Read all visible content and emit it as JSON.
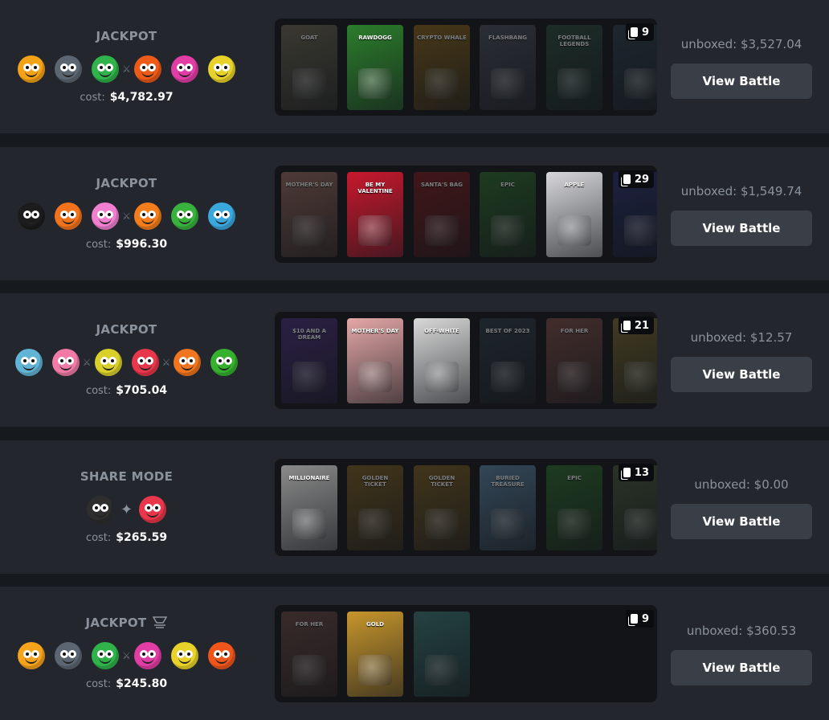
{
  "battles": [
    {
      "mode": "JACKPOT",
      "cost_label": "cost:",
      "cost": "$4,782.97",
      "unboxed": "unboxed: $3,527.04",
      "case_count": "9",
      "button": "View Battle",
      "players": [
        {
          "icon": "orange-smiley-avatar",
          "color": "#f5a316"
        },
        {
          "icon": "gray-creature-avatar",
          "color": "#5c6672"
        },
        {
          "icon": "green-grin-avatar",
          "color": "#2fb34a"
        },
        {
          "sep": "vs"
        },
        {
          "icon": "orange-blob-avatar",
          "color": "#ee5a17"
        },
        {
          "icon": "pink-eyeball-avatar",
          "color": "#e13da5"
        },
        {
          "icon": "yellow-face-avatar",
          "color": "#e8d22a"
        }
      ],
      "cases": [
        {
          "title": "GOAT",
          "color": "#6d6650",
          "dim": true
        },
        {
          "title": "RAWDOGG",
          "color": "#2b7d2c",
          "dim": false
        },
        {
          "title": "CRYPTO WHALE",
          "color": "#8a6218",
          "dim": true
        },
        {
          "title": "FLASHBANG",
          "color": "#4b4e5a",
          "dim": true
        },
        {
          "title": "FOOTBALL LEGENDS",
          "color": "#2d4a3b",
          "dim": true
        },
        {
          "title": "",
          "color": "#2e3e4a",
          "dim": true
        }
      ]
    },
    {
      "mode": "JACKPOT",
      "cost_label": "cost:",
      "cost": "$996.30",
      "unboxed": "unboxed: $1,549.74",
      "case_count": "29",
      "button": "View Battle",
      "players": [
        {
          "icon": "black-gold-avatar",
          "color": "#1c1c1c"
        },
        {
          "icon": "orange-surprised-avatar",
          "color": "#f2731c"
        },
        {
          "icon": "pink-blob-avatar",
          "color": "#f07fd0"
        },
        {
          "sep": "vs"
        },
        {
          "icon": "orange-ball-avatar",
          "color": "#f57d1c"
        },
        {
          "icon": "green-frog-avatar",
          "color": "#39b23d"
        },
        {
          "icon": "blue-bird-avatar",
          "color": "#3aa8dd"
        }
      ],
      "cases": [
        {
          "title": "MOTHER'S DAY",
          "color": "#9a6a5b",
          "dim": true
        },
        {
          "title": "BE MY VALENTINE",
          "color": "#c8182d",
          "dim": false
        },
        {
          "title": "SANTA'S BAG",
          "color": "#7d1a1c",
          "dim": true
        },
        {
          "title": "EPIC",
          "color": "#2e6b2a",
          "dim": true
        },
        {
          "title": "APPLE",
          "color": "#d8d8dc",
          "dim": false
        },
        {
          "title": "",
          "color": "#2a2f6a",
          "dim": true
        }
      ]
    },
    {
      "mode": "JACKPOT",
      "cost_label": "cost:",
      "cost": "$705.04",
      "unboxed": "unboxed: $12.57",
      "case_count": "21",
      "button": "View Battle",
      "players": [
        {
          "icon": "pixel-cyan-avatar",
          "color": "#62b4d6"
        },
        {
          "icon": "pink-sad-avatar",
          "color": "#f27aa6"
        },
        {
          "sep": "vs"
        },
        {
          "icon": "yellow-grin-avatar",
          "color": "#d9d02a"
        },
        {
          "icon": "red-lips-avatar",
          "color": "#e8364a"
        },
        {
          "sep": "vs"
        },
        {
          "icon": "orange-grin-avatar",
          "color": "#f0751e"
        },
        {
          "icon": "green-monster-avatar",
          "color": "#35b12e"
        }
      ],
      "cases": [
        {
          "title": "$10 AND A DREAM",
          "color": "#4b2f7a",
          "dim": true
        },
        {
          "title": "MOTHER'S DAY",
          "color": "#e4a7a7",
          "dim": false
        },
        {
          "title": "OFF-WHITE",
          "color": "#d9d9d9",
          "dim": false
        },
        {
          "title": "BEST OF 2023",
          "color": "#2d3a43",
          "dim": true
        },
        {
          "title": "FOR HER",
          "color": "#7d4c45",
          "dim": true
        },
        {
          "title": "",
          "color": "#7a6a2b",
          "dim": true
        }
      ]
    },
    {
      "mode": "SHARE MODE",
      "cost_label": "cost:",
      "cost": "$265.59",
      "unboxed": "unboxed: $0.00",
      "case_count": "13",
      "button": "View Battle",
      "players": [
        {
          "icon": "dark-halo-avatar",
          "color": "#2e2e2e"
        },
        {
          "sep": "plus"
        },
        {
          "icon": "red-lips-avatar",
          "color": "#e8364a"
        }
      ],
      "cases": [
        {
          "title": "MILLIONAIRE",
          "color": "#8a8a8a",
          "dim": false
        },
        {
          "title": "GOLDEN TICKET",
          "color": "#7d5d1f",
          "dim": true
        },
        {
          "title": "GOLDEN TICKET",
          "color": "#7d5d1f",
          "dim": true
        },
        {
          "title": "BURIED TREASURE",
          "color": "#5d84a3",
          "dim": true
        },
        {
          "title": "EPIC",
          "color": "#2e6b2a",
          "dim": true
        },
        {
          "title": "",
          "color": "#4a5a3a",
          "dim": true
        }
      ]
    },
    {
      "mode": "JACKPOT",
      "cost_label": "cost:",
      "cost": "$245.80",
      "unboxed": "unboxed: $360.53",
      "case_count": "9",
      "button": "View Battle",
      "players": [
        {
          "icon": "orange-white-avatar",
          "color": "#f5a21c"
        },
        {
          "icon": "gray-creature-avatar",
          "color": "#5c6672"
        },
        {
          "icon": "green-grin-avatar",
          "color": "#2fb34a"
        },
        {
          "sep": "vs"
        },
        {
          "icon": "pink-eyeball-avatar",
          "color": "#e13da5"
        },
        {
          "icon": "yellow-face-avatar",
          "color": "#e8d22a"
        },
        {
          "icon": "red-orange-avatar",
          "color": "#f0561c"
        }
      ],
      "cases": [
        {
          "title": "FOR HER",
          "color": "#6b4740",
          "dim": true
        },
        {
          "title": "GOLD",
          "color": "#c7962c",
          "dim": false
        },
        {
          "title": "",
          "color": "#3b7a74",
          "dim": true
        }
      ]
    }
  ]
}
